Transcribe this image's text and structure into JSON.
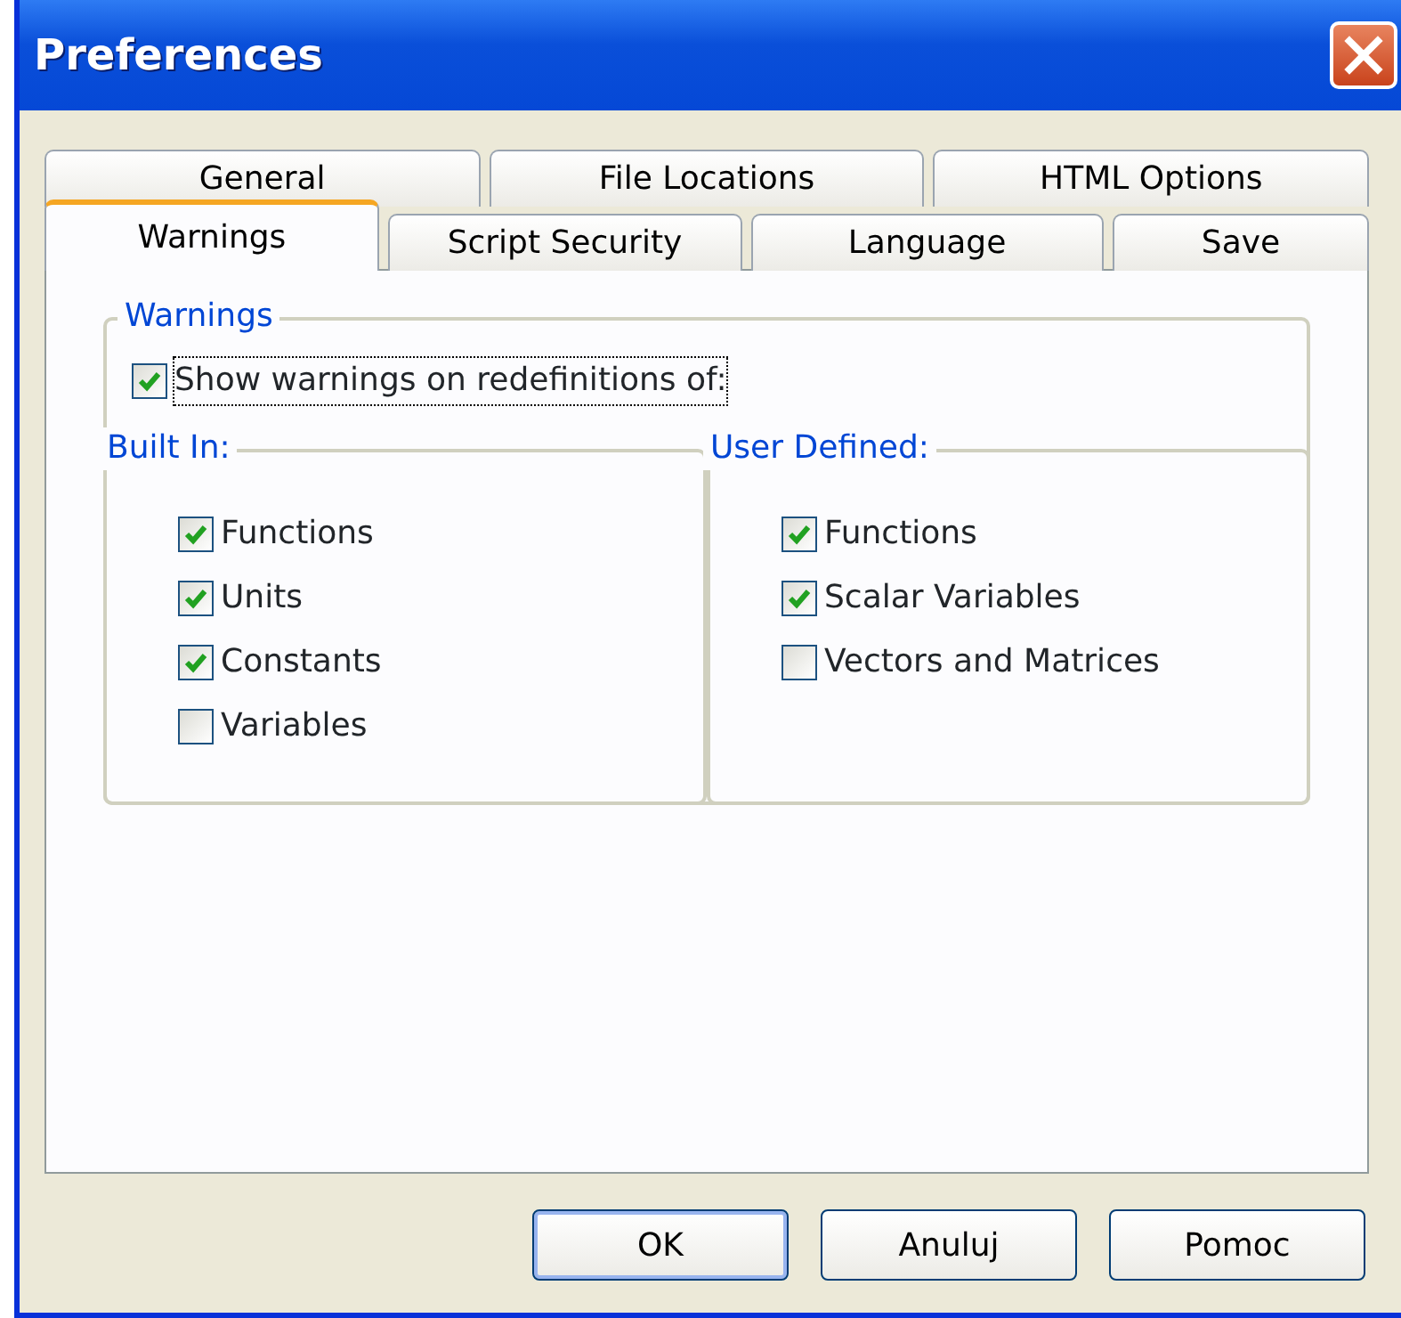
{
  "window": {
    "title": "Preferences"
  },
  "tab_rows": [
    [
      {
        "label": "General",
        "selected": false
      },
      {
        "label": "File Locations",
        "selected": false
      },
      {
        "label": "HTML Options",
        "selected": false
      }
    ],
    [
      {
        "label": "Warnings",
        "selected": true
      },
      {
        "label": "Script Security",
        "selected": false
      },
      {
        "label": "Language",
        "selected": false
      },
      {
        "label": "Save",
        "selected": false
      }
    ]
  ],
  "warnings_group": {
    "title": "Warnings",
    "master": {
      "label": "Show warnings on redefinitions of:",
      "checked": true
    },
    "groups": [
      {
        "title": "Built In:",
        "items": [
          {
            "label": "Functions",
            "checked": true
          },
          {
            "label": "Units",
            "checked": true
          },
          {
            "label": "Constants",
            "checked": true
          },
          {
            "label": "Variables",
            "checked": false
          }
        ]
      },
      {
        "title": "User Defined:",
        "items": [
          {
            "label": "Functions",
            "checked": true
          },
          {
            "label": "Scalar Variables",
            "checked": true
          },
          {
            "label": "Vectors and Matrices",
            "checked": false
          }
        ]
      }
    ]
  },
  "buttons": [
    {
      "label": "OK",
      "default": true
    },
    {
      "label": "Anuluj",
      "default": false
    },
    {
      "label": "Pomoc",
      "default": false
    }
  ]
}
